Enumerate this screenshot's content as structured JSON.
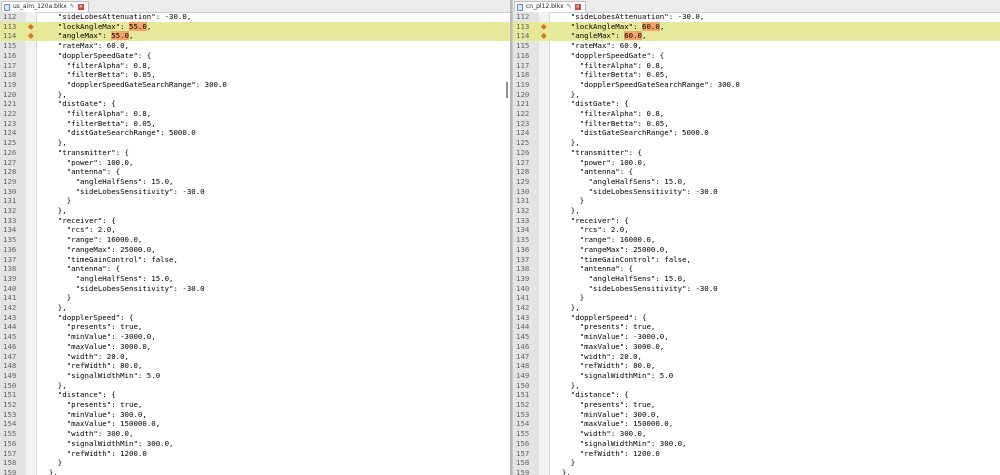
{
  "panes": [
    {
      "tab": "us_aim_120a.blkx",
      "diff_values": {
        "113": "55.0",
        "114": "55.0"
      }
    },
    {
      "tab": "cn_pl12.blkx",
      "diff_values": {
        "113": "60.0",
        "114": "60.0"
      }
    }
  ],
  "lines": [
    {
      "n": "112",
      "text": "    \"sideLobesAttenuation\": -30.0,"
    },
    {
      "n": "113",
      "pre": "    \"lockAngleMax\": ",
      "post": ",",
      "diff": true
    },
    {
      "n": "114",
      "pre": "    \"angleMax\": ",
      "post": ",",
      "diff": true
    },
    {
      "n": "115",
      "text": "    \"rateMax\": 60.0,"
    },
    {
      "n": "116",
      "text": "    \"dopplerSpeedGate\": {"
    },
    {
      "n": "117",
      "text": "      \"filterAlpha\": 0.8,"
    },
    {
      "n": "118",
      "text": "      \"filterBetta\": 0.05,"
    },
    {
      "n": "119",
      "text": "      \"dopplerSpeedGateSearchRange\": 300.0"
    },
    {
      "n": "120",
      "text": "    },"
    },
    {
      "n": "121",
      "text": "    \"distGate\": {"
    },
    {
      "n": "122",
      "text": "      \"filterAlpha\": 0.8,"
    },
    {
      "n": "123",
      "text": "      \"filterBetta\": 0.05,"
    },
    {
      "n": "124",
      "text": "      \"distGateSearchRange\": 5000.0"
    },
    {
      "n": "125",
      "text": "    },"
    },
    {
      "n": "126",
      "text": "    \"transmitter\": {"
    },
    {
      "n": "127",
      "text": "      \"power\": 100.0,"
    },
    {
      "n": "128",
      "text": "      \"antenna\": {"
    },
    {
      "n": "129",
      "text": "        \"angleHalfSens\": 15.0,"
    },
    {
      "n": "130",
      "text": "        \"sideLobesSensitivity\": -30.0"
    },
    {
      "n": "131",
      "text": "      }"
    },
    {
      "n": "132",
      "text": "    },"
    },
    {
      "n": "133",
      "text": "    \"receiver\": {"
    },
    {
      "n": "134",
      "text": "      \"rcs\": 2.0,"
    },
    {
      "n": "135",
      "text": "      \"range\": 16000.0,"
    },
    {
      "n": "136",
      "text": "      \"rangeMax\": 25000.0,"
    },
    {
      "n": "137",
      "text": "      \"timeGainControl\": false,"
    },
    {
      "n": "138",
      "text": "      \"antenna\": {"
    },
    {
      "n": "139",
      "text": "        \"angleHalfSens\": 15.0,"
    },
    {
      "n": "140",
      "text": "        \"sideLobesSensitivity\": -30.0"
    },
    {
      "n": "141",
      "text": "      }"
    },
    {
      "n": "142",
      "text": "    },"
    },
    {
      "n": "143",
      "text": "    \"dopplerSpeed\": {"
    },
    {
      "n": "144",
      "text": "      \"presents\": true,"
    },
    {
      "n": "145",
      "text": "      \"minValue\": -3000.0,"
    },
    {
      "n": "146",
      "text": "      \"maxValue\": 3000.0,"
    },
    {
      "n": "147",
      "text": "      \"width\": 20.0,"
    },
    {
      "n": "148",
      "text": "      \"refWidth\": 80.0,"
    },
    {
      "n": "149",
      "text": "      \"signalWidthMin\": 5.0"
    },
    {
      "n": "150",
      "text": "    },"
    },
    {
      "n": "151",
      "text": "    \"distance\": {"
    },
    {
      "n": "152",
      "text": "      \"presents\": true,"
    },
    {
      "n": "153",
      "text": "      \"minValue\": 300.0,"
    },
    {
      "n": "154",
      "text": "      \"maxValue\": 150000.0,"
    },
    {
      "n": "155",
      "text": "      \"width\": 300.0,"
    },
    {
      "n": "156",
      "text": "      \"signalWidthMin\": 300.0,"
    },
    {
      "n": "157",
      "text": "      \"refWidth\": 1200.0"
    },
    {
      "n": "158",
      "text": "    }"
    },
    {
      "n": "159",
      "text": "  },"
    }
  ]
}
